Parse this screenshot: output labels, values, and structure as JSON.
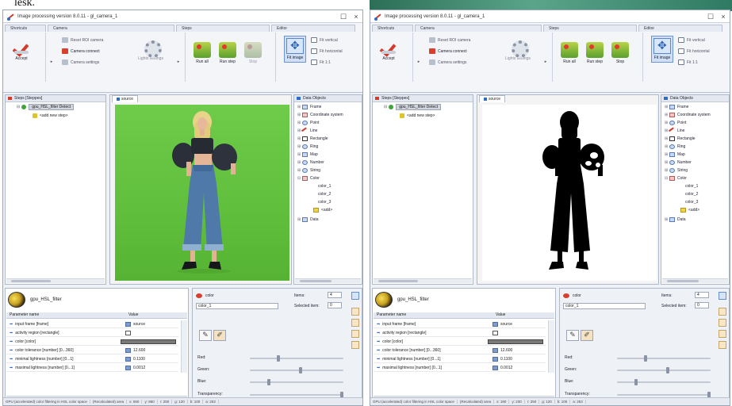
{
  "caption": "lesk.",
  "windows": [
    {
      "id": "left",
      "title": "Image processing version 8.0.11 - gl_camera_1",
      "ribbon": {
        "tabs": [
          "Shortcuts",
          "Camera",
          "Steps",
          "Editor"
        ],
        "accept": "Accept",
        "reset_label": "Reset ROI camera",
        "camera_connect": "Camera connect",
        "camera_settings": "Camera settings",
        "lights_settings": "Lights settings",
        "run_all": "Run all",
        "run_step": "Run step",
        "stop": "Stop",
        "fit_image": "Fit image",
        "fit_vertical": "Fit vertical",
        "fit_horizontal": "Fit horizontal",
        "fit_ratio": "Fit 1:1"
      },
      "steps": {
        "header": "Steps [Steppes]",
        "items": [
          "gpu_HSL_filter Detect",
          "<add new step>"
        ]
      },
      "viewer": {
        "tab": "source",
        "mode": "green"
      },
      "objects": {
        "header": "Data Objects",
        "items": [
          "Frame",
          "Coordinate system",
          "Point",
          "Line",
          "Rectangle",
          "Ring",
          "Map",
          "Number",
          "String",
          "Color",
          "color_1",
          "color_2",
          "color_3",
          "<add>",
          "Data"
        ]
      },
      "props": {
        "filter_name": "gpu_HSL_filter",
        "col_param": "Parameter name",
        "col_value": "Value",
        "rows": [
          {
            "name": "input frame [frame]",
            "value": "source"
          },
          {
            "name": "activity region [rectangle]",
            "value": ""
          },
          {
            "name": "color [color]",
            "value": ""
          },
          {
            "name": "color tolerance [number] [0...360]",
            "value": "12.600"
          },
          {
            "name": "minimal lightness [number] [0...1]",
            "value": "0.1100"
          },
          {
            "name": "maximal lightness [number] [0...1]",
            "value": "0.0012"
          }
        ]
      },
      "color_panel": {
        "type_label": "color",
        "name_value": "color_1",
        "items_label": "Items:",
        "items_value": "4",
        "selected_label": "Selected item:",
        "selected_value": "0",
        "red": "Red:",
        "green": "Green:",
        "blue": "Blue:",
        "transparency": "Transparency:"
      },
      "status": [
        "GPU (accelerated) color filtering in HSL color space",
        "(Recalculated) area",
        "x: 650",
        "y: 860",
        "r: 250",
        "g: 120",
        "b: 100",
        "a: 253"
      ]
    },
    {
      "id": "right",
      "title": "Image processing version 8.0.11 - gl_camera_1",
      "ribbon": {
        "tabs": [
          "Shortcuts",
          "Camera",
          "Steps",
          "Editor"
        ],
        "accept": "Accept",
        "reset_label": "Reset ROI camera",
        "camera_connect": "Camera connect",
        "camera_settings": "Camera settings",
        "lights_settings": "Lights settings",
        "run_all": "Run all",
        "run_step": "Run step",
        "stop": "Stop",
        "fit_image": "Fit image",
        "fit_vertical": "Fit vertical",
        "fit_horizontal": "Fit horizontal",
        "fit_ratio": "Fit 1:1"
      },
      "steps": {
        "header": "Steps [Steppes]",
        "items": [
          "gpu_HSL_filter Detect",
          "<add new step>"
        ]
      },
      "viewer": {
        "tab": "source",
        "mode": "white"
      },
      "objects": {
        "header": "Data Objects",
        "items": [
          "Frame",
          "Coordinate system",
          "Point",
          "Line",
          "Rectangle",
          "Ring",
          "Map",
          "Number",
          "String",
          "Color",
          "color_1",
          "color_2",
          "color_3",
          "<add>",
          "Data"
        ]
      },
      "props": {
        "filter_name": "gpu_HSL_filter",
        "col_param": "Parameter name",
        "col_value": "Value",
        "rows": [
          {
            "name": "input frame [frame]",
            "value": "source"
          },
          {
            "name": "activity region [rectangle]",
            "value": ""
          },
          {
            "name": "color [color]",
            "value": ""
          },
          {
            "name": "color tolerance [number] [0...360]",
            "value": "12.600"
          },
          {
            "name": "minimal lightness [number] [0...1]",
            "value": "0.1100"
          },
          {
            "name": "maximal lightness [number] [0...1]",
            "value": "0.0012"
          }
        ]
      },
      "color_panel": {
        "type_label": "color",
        "name_value": "color_1",
        "items_label": "Items:",
        "items_value": "4",
        "selected_label": "Selected item:",
        "selected_value": "0",
        "red": "Red:",
        "green": "Green:",
        "blue": "Blue:",
        "transparency": "Transparency:"
      },
      "status": [
        "GPU (accelerated) color filtering in HSL color space",
        "(Recalculated) area",
        "x: 190",
        "y: 230",
        "r: 250",
        "g: 120",
        "b: 100",
        "a: 253"
      ]
    }
  ],
  "colors": {
    "accent_red": "#d03a2a",
    "chroma_green": "#5dbd3a",
    "panel_bg": "#eef1f6"
  }
}
